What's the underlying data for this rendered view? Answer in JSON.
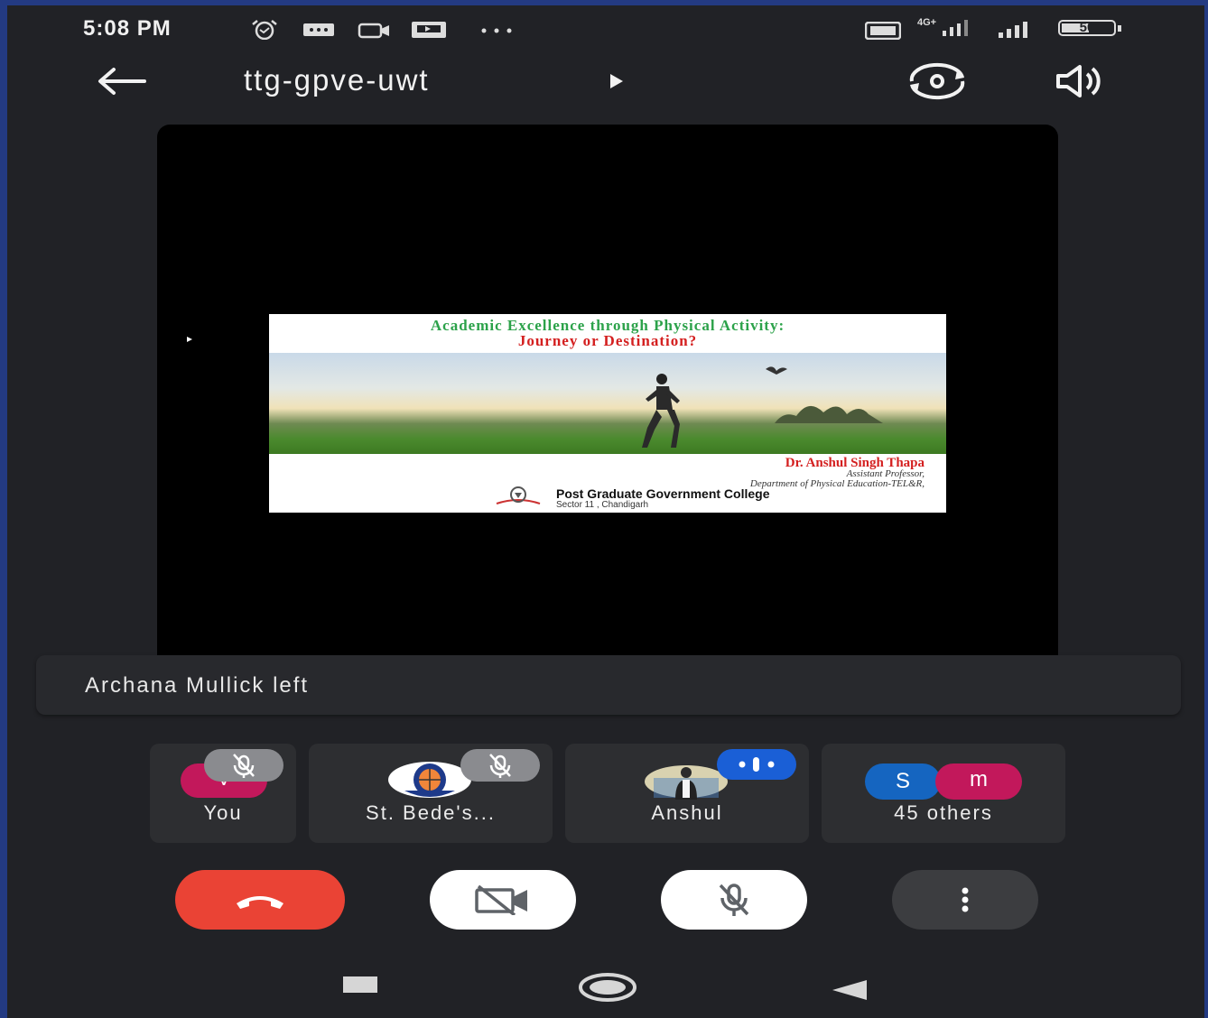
{
  "status_bar": {
    "time": "5:08 PM",
    "icons": [
      "alarm-icon",
      "message-icon",
      "video-icon",
      "cast-icon",
      "more-dots-icon",
      "volte-icon",
      "signal-4g-icon",
      "signal-icon",
      "battery-icon"
    ],
    "battery": "50",
    "network": "4G+"
  },
  "header": {
    "meeting_code": "ttg-gpve-uwt"
  },
  "slide": {
    "title_line1": "Academic Excellence through Physical Activity:",
    "title_line2": "Journey or Destination?",
    "author": "Dr. Anshul Singh Thapa",
    "role": "Assistant Professor,",
    "department": "Department of Physical Education-TEL&R,",
    "college": "Post Graduate Government College",
    "sector": "Sector 11 , Chandigarh"
  },
  "notification": {
    "text": "Archana Mullick left"
  },
  "participants": [
    {
      "name": "You",
      "avatar_letter": "V",
      "muted": true
    },
    {
      "name": "St. Bede's...",
      "muted": true
    },
    {
      "name": "Anshul",
      "speaking": true
    },
    {
      "name": "45 others",
      "avatar_letters": [
        "S",
        "m"
      ]
    }
  ],
  "controls": {
    "end_call_color": "#ea4335",
    "buttons": [
      "end-call",
      "camera-off",
      "mic-off",
      "more-options"
    ]
  }
}
